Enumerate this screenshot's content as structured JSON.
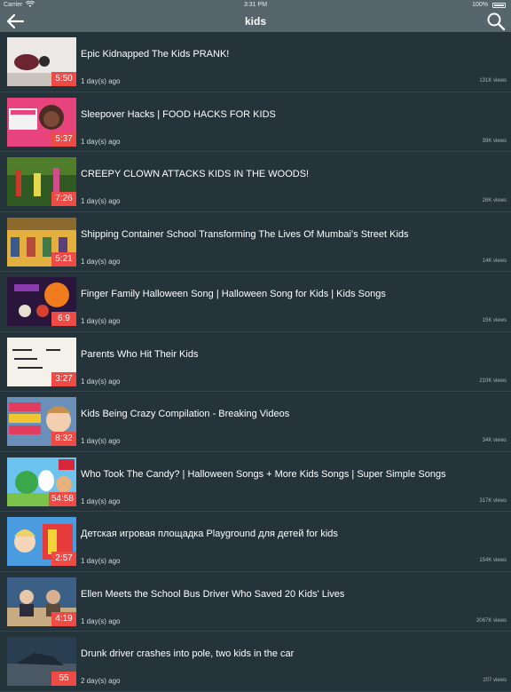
{
  "status_bar": {
    "carrier": "Carrier",
    "time": "3:31 PM",
    "battery": "100%"
  },
  "nav_bar": {
    "title": "kids",
    "back_icon": "arrow-left-icon",
    "search_icon": "search-icon"
  },
  "colors": {
    "nav_background": "#55656b",
    "list_background": "#24343a",
    "duration_badge": "#ef4b46"
  },
  "videos": [
    {
      "title": "Epic Kidnapped The Kids PRANK!",
      "duration": "5:50",
      "age": "1 day(s) ago",
      "views": "131K views"
    },
    {
      "title": "Sleepover Hacks | FOOD HACKS FOR KIDS",
      "duration": "5:37",
      "age": "1 day(s) ago",
      "views": "39K views"
    },
    {
      "title": "CREEPY CLOWN ATTACKS KIDS IN THE WOODS!",
      "duration": "7:26",
      "age": "1 day(s) ago",
      "views": "26K views"
    },
    {
      "title": "Shipping Container School Transforming The Lives Of Mumbai’s Street Kids",
      "duration": "5:21",
      "age": "1 day(s) ago",
      "views": "14K views"
    },
    {
      "title": "Finger Family Halloween Song | Halloween Song for Kids | Kids Songs",
      "duration": "6:9",
      "age": "1 day(s) ago",
      "views": "15K views"
    },
    {
      "title": "Parents Who Hit Their Kids",
      "duration": "3:27",
      "age": "1 day(s) ago",
      "views": "210K views"
    },
    {
      "title": "Kids Being Crazy Compilation - Breaking Videos",
      "duration": "8:32",
      "age": "1 day(s) ago",
      "views": "34K views"
    },
    {
      "title": "Who Took The Candy? | Halloween Songs + More Kids Songs | Super Simple Songs",
      "duration": "54:58",
      "age": "1 day(s) ago",
      "views": "317K views"
    },
    {
      "title": "Детская игровая площадка Playground для детей for kids",
      "duration": "2:57",
      "age": "1 day(s) ago",
      "views": "154K views"
    },
    {
      "title": "Ellen Meets the School Bus Driver Who Saved 20 Kids' Lives",
      "duration": "4:19",
      "age": "1 day(s) ago",
      "views": "2067K views"
    },
    {
      "title": "Drunk driver crashes into pole, two kids in the car",
      "duration": "55",
      "age": "2 day(s) ago",
      "views": "207 views"
    }
  ]
}
